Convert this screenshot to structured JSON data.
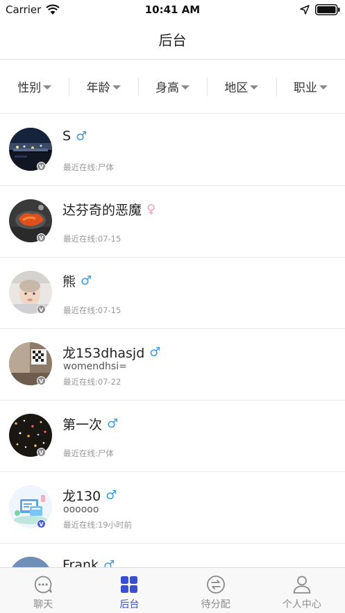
{
  "status_bar": {
    "carrier": "Carrier",
    "time": "10:41 AM"
  },
  "nav": {
    "title": "后台"
  },
  "filters": [
    {
      "label": "性别"
    },
    {
      "label": "年龄"
    },
    {
      "label": "身高"
    },
    {
      "label": "地区"
    },
    {
      "label": "职业"
    }
  ],
  "users": [
    {
      "name": "S",
      "gender_symbol": "♂",
      "gender": "male",
      "signature": "",
      "last_online": "最近在线:尸体",
      "badge": "V"
    },
    {
      "name": "达芬奇的恶魔",
      "gender_symbol": "♀",
      "gender": "female",
      "signature": "",
      "last_online": "最近在线:07-15",
      "badge": "V"
    },
    {
      "name": "熊",
      "gender_symbol": "♂",
      "gender": "male",
      "signature": "",
      "last_online": "最近在线:07-15",
      "badge": "V"
    },
    {
      "name": "龙153dhasjd",
      "gender_symbol": "♂",
      "gender": "male",
      "signature": "womendhsi=",
      "last_online": "最近在线:07-22",
      "badge": "V"
    },
    {
      "name": "第一次",
      "gender_symbol": "♂",
      "gender": "male",
      "signature": "",
      "last_online": "最近在线:尸体",
      "badge": "V"
    },
    {
      "name": "龙130",
      "gender_symbol": "♂",
      "gender": "male",
      "signature": "oooooo",
      "last_online": "最近在线:19小时前",
      "badge": "V"
    },
    {
      "name": "Frank",
      "gender_symbol": "♂",
      "gender": "male",
      "signature": "",
      "last_online": "",
      "badge": ""
    }
  ],
  "tabs": [
    {
      "label": "聊天",
      "icon": "chat-bubble-icon",
      "active": false
    },
    {
      "label": "后台",
      "icon": "grid-icon",
      "active": true
    },
    {
      "label": "待分配",
      "icon": "swap-arrows-icon",
      "active": false
    },
    {
      "label": "个人中心",
      "icon": "person-icon",
      "active": false
    }
  ],
  "colors": {
    "accent": "#3a4fd0",
    "male": "#3a9be8",
    "female": "#f0a3c0",
    "inactive": "#8a8a8a"
  }
}
